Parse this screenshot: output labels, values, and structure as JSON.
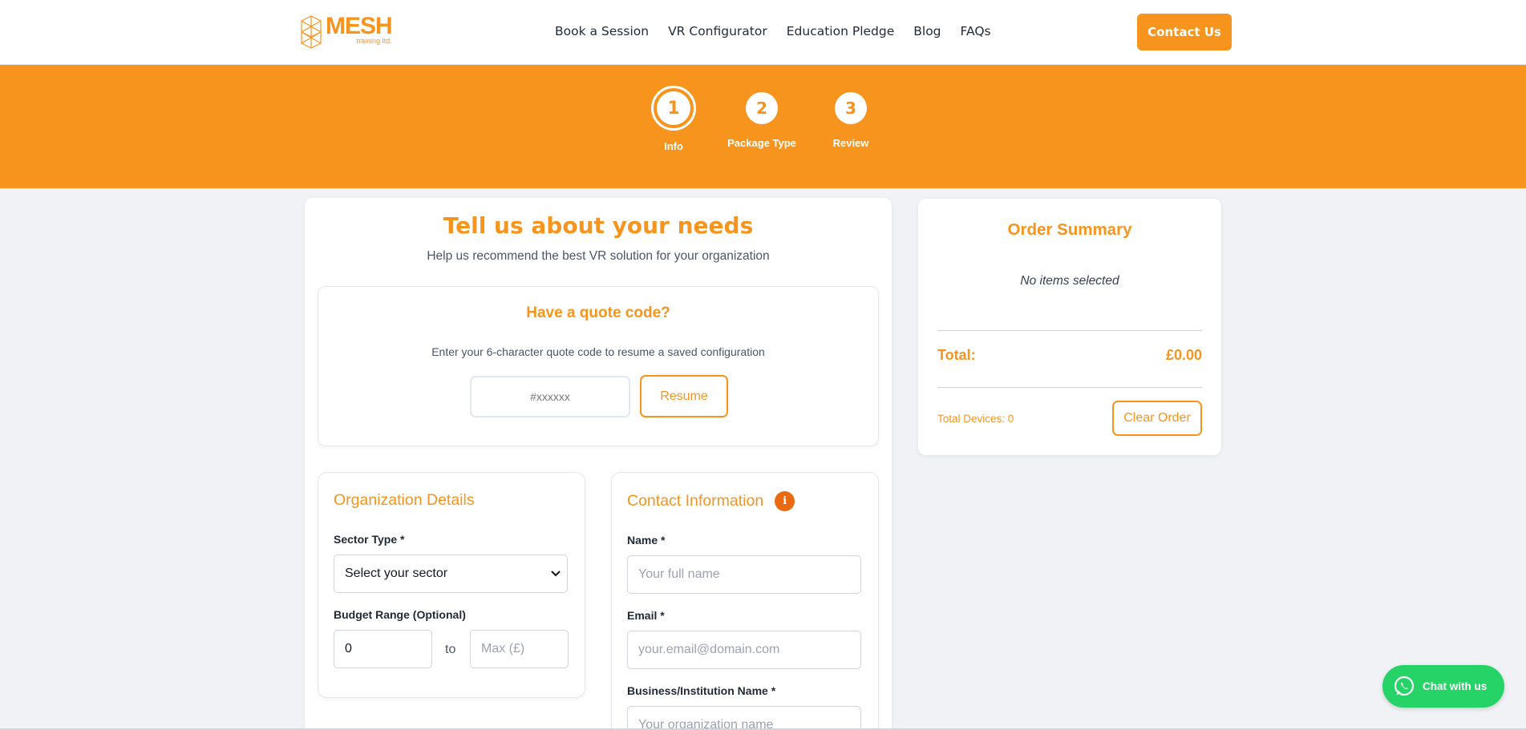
{
  "header": {
    "logo_main": "MESH",
    "logo_sub": "training ltd.",
    "nav": [
      "Book a Session",
      "VR Configurator",
      "Education Pledge",
      "Blog",
      "FAQs"
    ],
    "contact_label": "Contact Us"
  },
  "stepper": {
    "steps": [
      {
        "number": "1",
        "label": "Info",
        "active": true
      },
      {
        "number": "2",
        "label": "Package Type",
        "active": false
      },
      {
        "number": "3",
        "label": "Review",
        "active": false
      }
    ]
  },
  "main": {
    "title": "Tell us about your needs",
    "subtitle": "Help us recommend the best VR solution for your organization",
    "quote": {
      "title": "Have a quote code?",
      "description": "Enter your 6-character quote code to resume a saved configuration",
      "placeholder": "#xxxxxx",
      "resume_label": "Resume"
    },
    "org": {
      "title": "Organization Details",
      "sector_label": "Sector Type *",
      "sector_value": "Select your sector",
      "budget_label": "Budget Range (Optional)",
      "budget_min": "0",
      "budget_to": "to",
      "budget_max_placeholder": "Max (£)"
    },
    "contact": {
      "title": "Contact Information",
      "info_icon": "i",
      "name_label": "Name *",
      "name_placeholder": "Your full name",
      "email_label": "Email *",
      "email_placeholder": "your.email@domain.com",
      "business_label": "Business/Institution Name *",
      "business_placeholder": "Your organization name"
    }
  },
  "summary": {
    "title": "Order Summary",
    "empty_text": "No items selected",
    "total_label": "Total:",
    "total_value": "£0.00",
    "devices_label": "Total Devices: 0",
    "clear_label": "Clear Order"
  },
  "chat": {
    "label": "Chat with us"
  },
  "colors": {
    "accent": "#f7941d",
    "info_badge": "#ea6a12",
    "chat": "#25d366",
    "page_bg": "#f0f2f6"
  },
  "icons": {
    "logo": "mesh-logo-icon",
    "info": "info-icon",
    "chat": "whatsapp-icon",
    "select": "chevron-down-icon"
  }
}
